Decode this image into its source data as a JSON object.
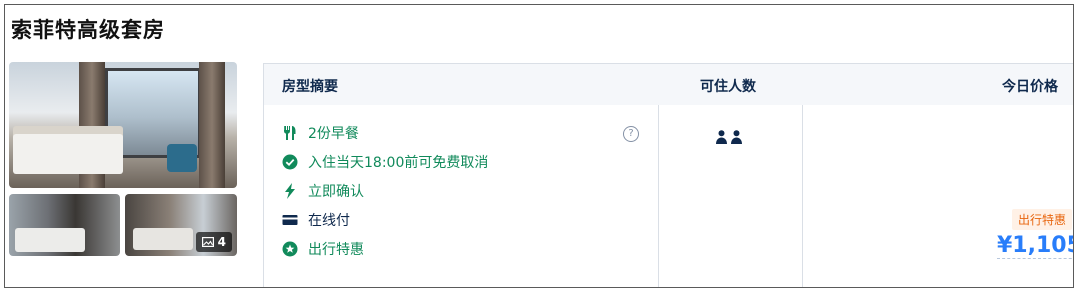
{
  "room": {
    "title": "索菲特高级套房"
  },
  "photos": {
    "more_count": "4",
    "more_icon": "image-icon"
  },
  "table": {
    "headers": {
      "summary": "房型摘要",
      "guests": "可住人数",
      "price": "今日价格"
    }
  },
  "features": [
    {
      "icon": "utensils-icon",
      "label": "2份早餐",
      "color": "#118a5b"
    },
    {
      "icon": "check-circle-icon",
      "label": "入住当天18:00前可免费取消",
      "color": "#118a5b"
    },
    {
      "icon": "lightning-icon",
      "label": "立即确认",
      "color": "#118a5b"
    },
    {
      "icon": "credit-card-icon",
      "label": "在线付",
      "color": "#0f294d"
    },
    {
      "icon": "star-badge-icon",
      "label": "出行特惠",
      "color": "#118a5b"
    }
  ],
  "help": {
    "symbol": "?"
  },
  "occupancy": {
    "count": 2,
    "icon": "person-icon"
  },
  "pricing": {
    "tag": "出行特惠",
    "amount": "¥1,105",
    "currency_color": "#287dfa"
  }
}
